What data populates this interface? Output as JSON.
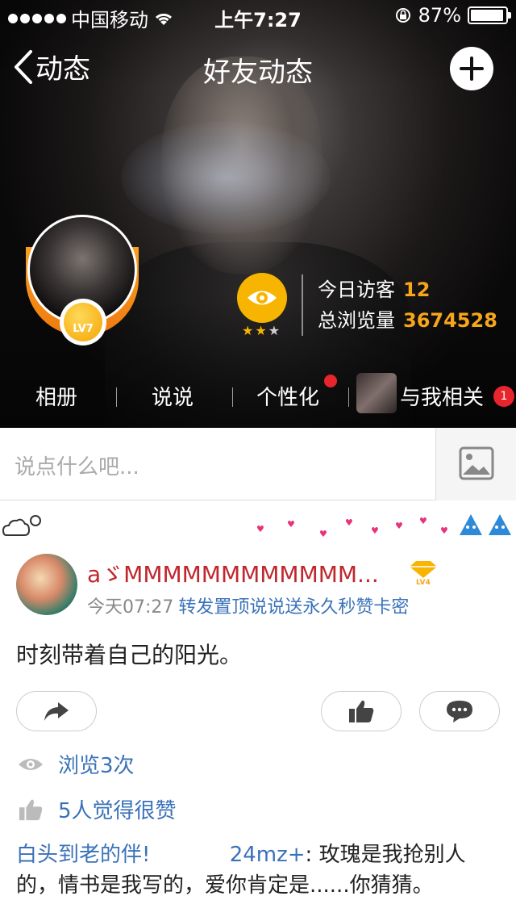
{
  "status_bar": {
    "carrier": "中国移动",
    "time": "上午7:27",
    "battery": "87%",
    "battery_level": 0.87
  },
  "nav": {
    "back_label": "动态",
    "title": "好友动态"
  },
  "profile": {
    "level": "LV7",
    "stars_filled": 2,
    "stars_total": 3,
    "today_visitors_label": "今日访客",
    "today_visitors": "12",
    "total_views_label": "总浏览量",
    "total_views": "3674528"
  },
  "tabs": [
    {
      "label": "相册"
    },
    {
      "label": "说说"
    },
    {
      "label": "个性化",
      "has_dot": true
    },
    {
      "label": "与我相关",
      "badge": "1"
    }
  ],
  "composer": {
    "placeholder": "说点什么吧..."
  },
  "post": {
    "author": "aゞMMMMMMMMMMMM...",
    "author_level": "LV4",
    "time": "今天07:27",
    "tagline": "转发置顶说说送永久秒赞卡密",
    "content": "时刻带着自己的阳光。",
    "views": "浏览3次",
    "likes": "5人觉得很赞",
    "comment": {
      "author": "白头到老的伴!",
      "to": "24mz+",
      "text": ": 玫瑰是我抢别人的，情书是我写的，爱你肯定是......你猜猜。"
    }
  },
  "colors": {
    "accent_orange": "#f7a51a",
    "link_blue": "#3a72b8",
    "name_red": "#c0272d",
    "badge_red": "#e8242d"
  }
}
